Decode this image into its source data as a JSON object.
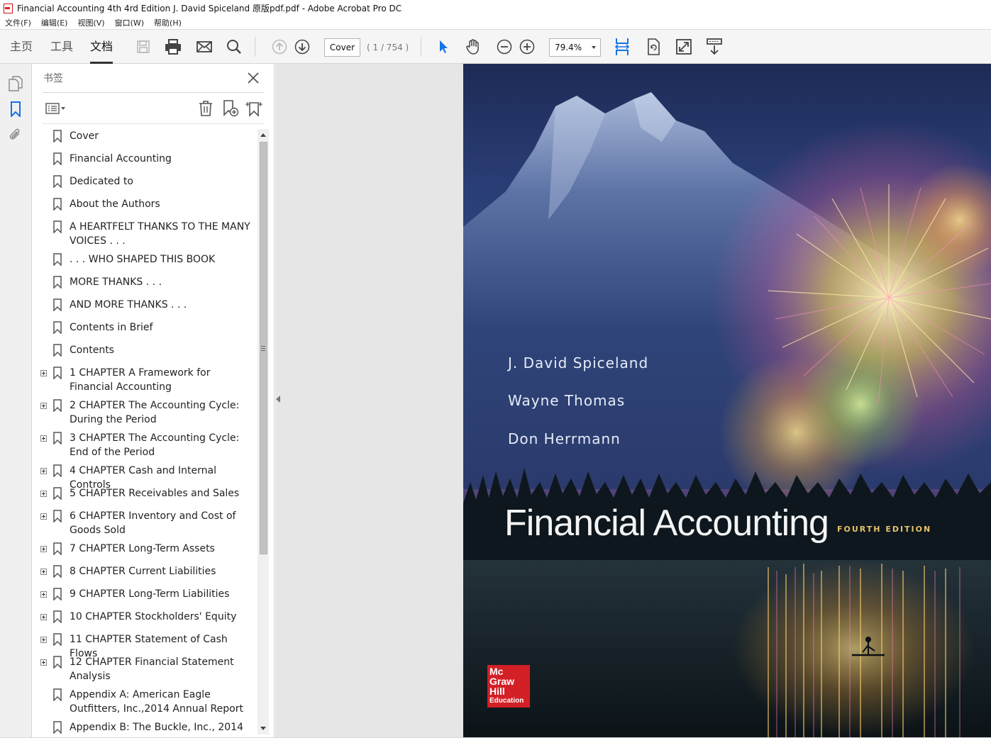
{
  "window": {
    "title": "Financial Accounting 4th 4rd Edition J. David Spiceland 原版pdf.pdf - Adobe Acrobat Pro DC"
  },
  "menu": {
    "items": [
      "文件(F)",
      "编辑(E)",
      "视图(V)",
      "窗口(W)",
      "帮助(H)"
    ]
  },
  "toolbar": {
    "tabs": [
      "主页",
      "工具",
      "文档"
    ],
    "active_tab": "文档",
    "page_label_value": "Cover",
    "page_count_text": "( 1 / 754 )",
    "zoom_value": "79.4%",
    "icons": [
      "save-icon",
      "print-icon",
      "email-icon",
      "search-icon",
      "prev-page-icon",
      "next-page-icon",
      "select-cursor-icon",
      "hand-tool-icon",
      "zoom-out-icon",
      "zoom-in-icon",
      "fit-width-icon",
      "rotate-page-icon",
      "full-screen-icon",
      "read-mode-icon"
    ],
    "accent_color": "#1473e6"
  },
  "navstrip": {
    "icons": [
      "page-thumbnails-icon",
      "bookmarks-icon",
      "attachments-icon"
    ]
  },
  "bookmarks_panel": {
    "title": "书签",
    "tools": [
      "options-menu-icon",
      "delete-bookmark-icon",
      "new-bookmark-icon",
      "bookmark-from-structure-icon"
    ],
    "items": [
      {
        "label": "Cover",
        "expandable": false
      },
      {
        "label": "Financial Accounting",
        "expandable": false
      },
      {
        "label": "Dedicated to",
        "expandable": false
      },
      {
        "label": "About the Authors",
        "expandable": false
      },
      {
        "label": "A HEARTFELT THANKS TO THE MANY VOICES . . .",
        "expandable": false
      },
      {
        "label": ". . . WHO SHAPED THIS BOOK",
        "expandable": false
      },
      {
        "label": "MORE THANKS . . .",
        "expandable": false
      },
      {
        "label": "AND MORE THANKS . . .",
        "expandable": false
      },
      {
        "label": "Contents in Brief",
        "expandable": false
      },
      {
        "label": "Contents",
        "expandable": false
      },
      {
        "label": "1 CHAPTER  A Framework for Financial Accounting",
        "expandable": true
      },
      {
        "label": "2 CHAPTER The Accounting Cycle: During  the Period",
        "expandable": true
      },
      {
        "label": "3 CHAPTER The Accounting Cycle: End of the Period",
        "expandable": true
      },
      {
        "label": "4 CHAPTER  Cash and Internal Controls",
        "expandable": true
      },
      {
        "label": "5 CHAPTER Receivables and Sales",
        "expandable": true
      },
      {
        "label": "6 CHAPTER Inventory and Cost of Goods Sold",
        "expandable": true
      },
      {
        "label": "7 CHAPTER Long-Term Assets",
        "expandable": true
      },
      {
        "label": "8 CHAPTER Current Liabilities",
        "expandable": true
      },
      {
        "label": "9 CHAPTER Long-Term Liabilities",
        "expandable": true
      },
      {
        "label": "10 CHAPTER Stockholders' Equity",
        "expandable": true
      },
      {
        "label": "11 CHAPTER Statement of Cash Flows",
        "expandable": true
      },
      {
        "label": "12 CHAPTER Financial Statement Analysis",
        "expandable": true
      },
      {
        "label": "Appendix A: American Eagle Outfitters, Inc.,2014 Annual Report",
        "expandable": false
      },
      {
        "label": "Appendix B: The Buckle, Inc., 2014",
        "expandable": false
      }
    ]
  },
  "document": {
    "cover": {
      "authors": [
        "J. David Spiceland",
        "Wayne Thomas",
        "Don Herrmann"
      ],
      "title": "Financial Accounting",
      "edition": "FOURTH EDITION",
      "publisher_lines": [
        "Mc",
        "Graw",
        "Hill",
        "Education"
      ],
      "publisher_color": "#d31f26"
    }
  }
}
